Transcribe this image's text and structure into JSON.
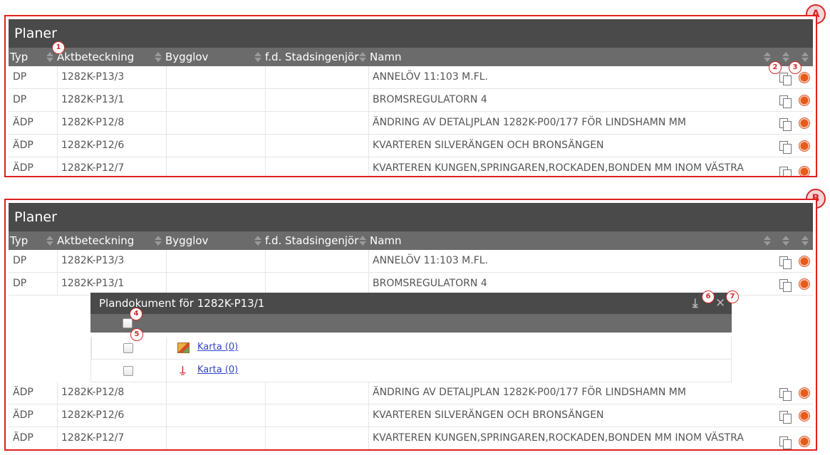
{
  "section_a": {
    "badge": "A",
    "title": "Planer",
    "columns": [
      "Typ",
      "Aktbeteckning",
      "Bygglov",
      "f.d. Stadsingenjör",
      "Namn"
    ],
    "rows": [
      {
        "typ": "DP",
        "akt": "1282K-P13/3",
        "namn": "ANNELÖV 11:103 M.FL."
      },
      {
        "typ": "DP",
        "akt": "1282K-P13/1",
        "namn": "BROMSREGULATORN 4"
      },
      {
        "typ": "ÄDP",
        "akt": "1282K-P12/8",
        "namn": "ÄNDRING AV DETALJPLAN 1282K-P00/177 FÖR LINDSHAMN MM"
      },
      {
        "typ": "ÄDP",
        "akt": "1282K-P12/6",
        "namn": "KVARTEREN SILVERÄNGEN OCH BRONSÄNGEN"
      },
      {
        "typ": "ÄDP",
        "akt": "1282K-P12/7",
        "namn": "KVARTEREN KUNGEN,SPRINGAREN,ROCKADEN,BONDEN MM INOM VÄSTRA"
      }
    ],
    "callouts": [
      "1",
      "2",
      "3"
    ]
  },
  "section_b": {
    "badge": "B",
    "title": "Planer",
    "columns": [
      "Typ",
      "Aktbeteckning",
      "Bygglov",
      "f.d. Stadsingenjör",
      "Namn"
    ],
    "rows_top": [
      {
        "typ": "DP",
        "akt": "1282K-P13/3",
        "namn": "ANNELÖV 11:103 M.FL."
      },
      {
        "typ": "DP",
        "akt": "1282K-P13/1",
        "namn": "BROMSREGULATORN 4"
      }
    ],
    "plandokument": {
      "title": "Plandokument för 1282K-P13/1",
      "documents": [
        {
          "label": "Karta (0)",
          "icon": "map-icon"
        },
        {
          "label": "Karta (0)",
          "icon": "pdf-icon"
        }
      ],
      "callouts": [
        "4",
        "5",
        "6",
        "7"
      ]
    },
    "rows_bottom": [
      {
        "typ": "ÄDP",
        "akt": "1282K-P12/8",
        "namn": "ÄNDRING AV DETALJPLAN 1282K-P00/177 FÖR LINDSHAMN MM"
      },
      {
        "typ": "ÄDP",
        "akt": "1282K-P12/6",
        "namn": "KVARTEREN SILVERÄNGEN OCH BRONSÄNGEN"
      },
      {
        "typ": "ÄDP",
        "akt": "1282K-P12/7",
        "namn": "KVARTEREN KUNGEN,SPRINGAREN,ROCKADEN,BONDEN MM INOM VÄSTRA"
      }
    ]
  },
  "colors": {
    "frame": "#e02020",
    "title_bar": "#4a4a4a",
    "header_bar": "#6b6b6b",
    "link": "#3344cc",
    "status_dot": "#e85a1a"
  }
}
